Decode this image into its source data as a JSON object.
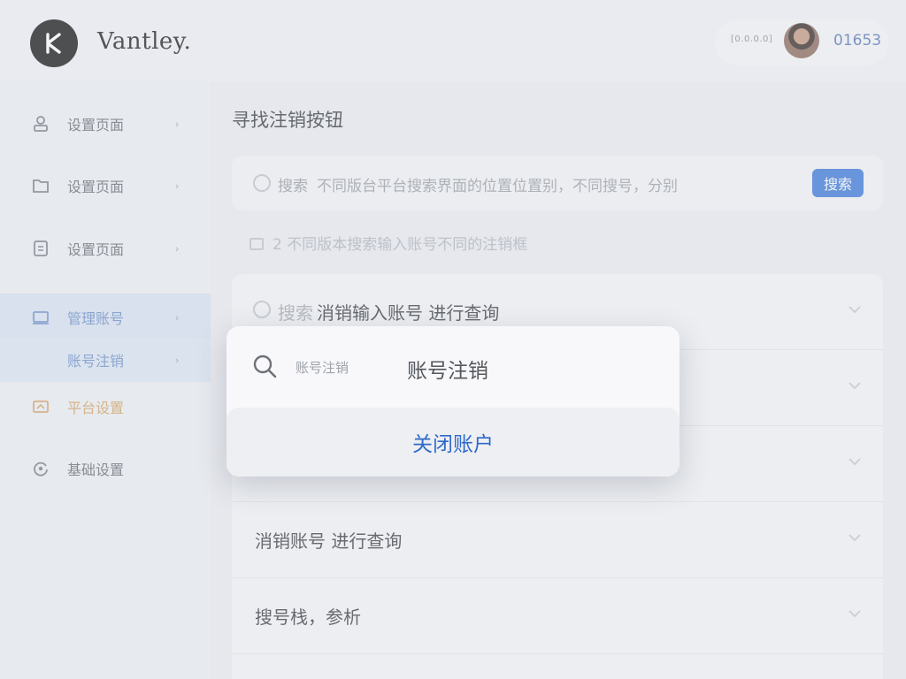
{
  "header": {
    "brand": "Vantley.",
    "user_sub": "[0.0.0.0]",
    "user_id": "01653"
  },
  "sidebar": {
    "items": [
      {
        "label": "设置页面",
        "icon": "user-icon"
      },
      {
        "label": "设置页面",
        "icon": "folder-icon"
      },
      {
        "label": "设置页面",
        "icon": "document-icon"
      },
      {
        "label": "管理账号",
        "icon": "monitor-icon"
      },
      {
        "label": "账号注销",
        "icon": ""
      },
      {
        "label": "平台设置",
        "icon": "card-icon"
      },
      {
        "label": "基础设置",
        "icon": "refresh-icon"
      }
    ]
  },
  "main": {
    "title": "寻找注销按钮",
    "search": {
      "tag": "搜索",
      "text": "不同版台平台搜索界面的位置位置别，不同搜号，分别",
      "button": "搜索"
    },
    "hint": "2 不同版本搜索输入账号不同的注销框",
    "rows": [
      {
        "tag": "搜索",
        "text": "消销输入账号 进行查询"
      },
      {
        "tag": "",
        "text": ""
      },
      {
        "tag": "",
        "text": ""
      },
      {
        "tag": "",
        "text": "消销账号  进行查询"
      },
      {
        "tag": "",
        "text": "搜号栈，参析"
      }
    ]
  },
  "popup": {
    "search_hint": "账号注销",
    "query": "账号注销",
    "action": "关闭账户"
  },
  "colors": {
    "accent": "#3e7bd9",
    "action_text": "#2f6ac9"
  }
}
